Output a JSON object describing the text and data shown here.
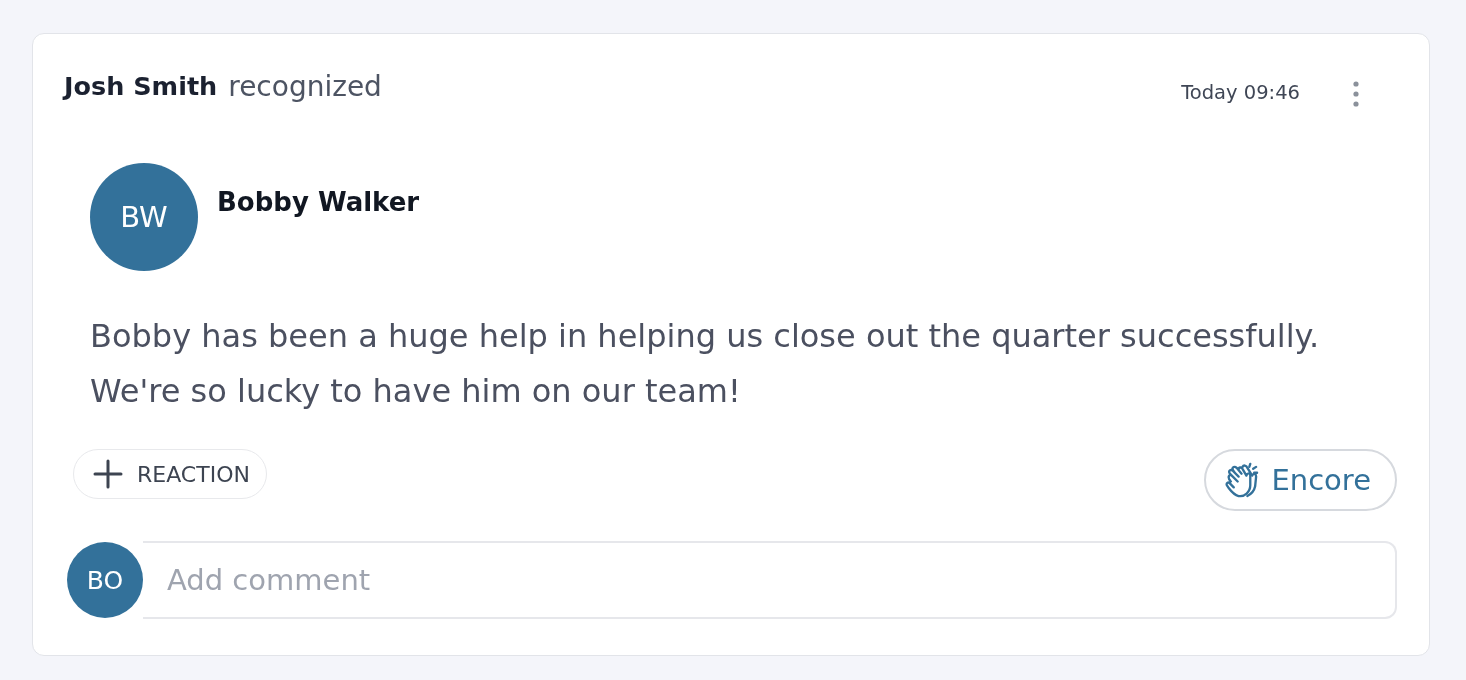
{
  "post": {
    "author": "Josh Smith",
    "action": "recognized",
    "timestamp": "Today 09:46"
  },
  "recipient": {
    "initials": "BW",
    "name": "Bobby Walker"
  },
  "message": "Bobby has been a huge help in helping us close out the quarter successfully. We're so lucky to have him on our team!",
  "actions": [
    {
      "kind": "reaction",
      "label": "REACTION"
    },
    {
      "kind": "encore",
      "label": "Encore"
    }
  ],
  "comment": {
    "initials": "BO",
    "placeholder": "Add comment"
  }
}
